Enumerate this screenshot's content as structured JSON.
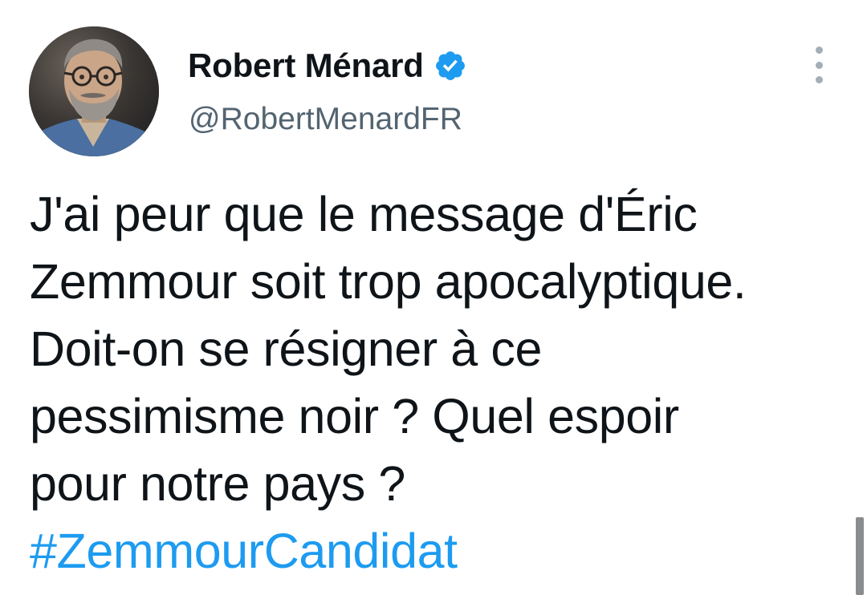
{
  "tweet": {
    "author": {
      "display_name": "Robert Ménard",
      "handle": "@RobertMenardFR",
      "verified": true,
      "avatar_icon": "profile-photo-avatar"
    },
    "text_lines": [
      "J'ai peur que le message d'Éric",
      "Zemmour soit trop apocalyptique.",
      "Doit-on se résigner à ce",
      "pessimisme noir ? Quel espoir",
      "pour notre pays ?"
    ],
    "hashtag": "#ZemmourCandidat",
    "more_icon": "more-options-icon"
  },
  "colors": {
    "text": "#0f1419",
    "secondary_text": "#536471",
    "accent": "#1d9bf0",
    "verified_badge": "#1d9bf0"
  }
}
